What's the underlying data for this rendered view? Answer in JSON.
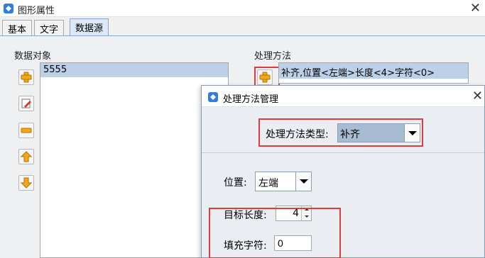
{
  "window": {
    "title": "图形属性",
    "close": "✕"
  },
  "tabs": [
    {
      "label": "基本",
      "active": false
    },
    {
      "label": "文字",
      "active": false
    },
    {
      "label": "数据源",
      "active": true
    }
  ],
  "data_objects": {
    "label": "数据对象",
    "items": [
      "5555"
    ],
    "buttons": [
      "add-icon",
      "edit-icon",
      "remove-icon",
      "move-up-icon",
      "move-down-icon"
    ]
  },
  "methods": {
    "label": "处理方法",
    "items": [
      "补齐,位置<左端>长度<4>字符<0>"
    ],
    "add_button": "add-icon"
  },
  "dialog": {
    "title": "处理方法管理",
    "close": "✕",
    "type_label": "处理方法类型:",
    "type_value": "补齐",
    "position_label": "位置:",
    "position_value": "左端",
    "target_length_label": "目标长度:",
    "target_length_value": "4",
    "fill_char_label": "填充字符:",
    "fill_char_value": "0"
  },
  "colors": {
    "highlight": "#e13c3c",
    "selection": "#bcd0e8",
    "accent_icon": "#f2a61a"
  }
}
